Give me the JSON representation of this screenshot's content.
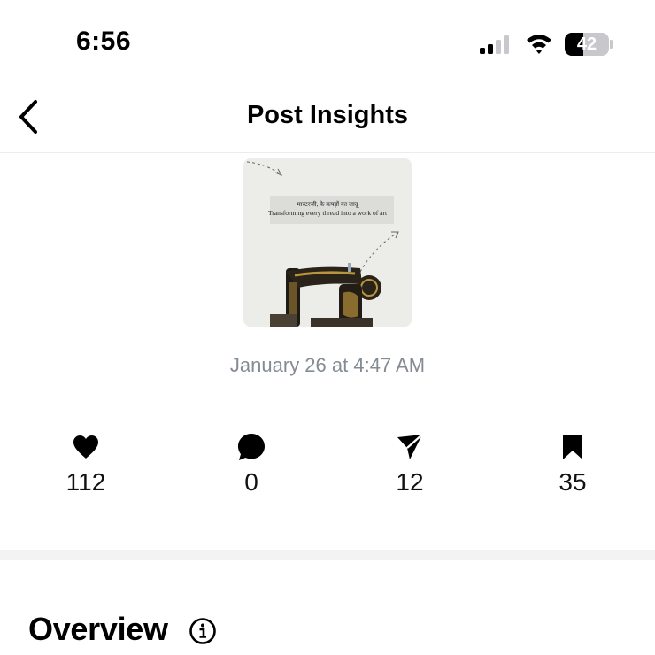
{
  "status_bar": {
    "time": "6:56",
    "battery_level": "42",
    "icons": [
      "cellular-signal-icon",
      "wifi-icon",
      "battery-icon"
    ]
  },
  "nav": {
    "title": "Post Insights",
    "back_icon": "chevron-left-icon"
  },
  "post": {
    "thumbnail_text_line1": "मास्टरजी, के कपड़ों का जादू",
    "thumbnail_text_line2": "Transforming every thread into a work of art",
    "date": "January 26 at 4:47 AM"
  },
  "metrics": [
    {
      "icon": "heart-icon",
      "label": "likes",
      "value": "112"
    },
    {
      "icon": "comment-icon",
      "label": "comments",
      "value": "0"
    },
    {
      "icon": "share-icon",
      "label": "shares",
      "value": "12"
    },
    {
      "icon": "bookmark-icon",
      "label": "saves",
      "value": "35"
    }
  ],
  "overview": {
    "title": "Overview",
    "info_icon": "info-icon"
  },
  "colors": {
    "date_text": "#858b94",
    "section_gap": "#f3f3f3",
    "battery_body": "#c7c7cc"
  }
}
